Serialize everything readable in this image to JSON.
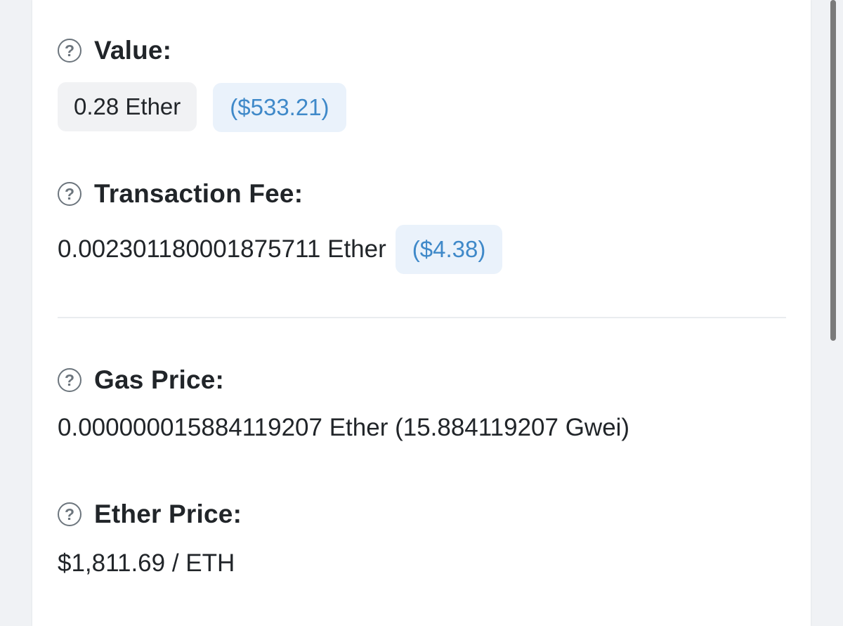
{
  "value": {
    "label": "Value:",
    "amount": "0.28 Ether",
    "usd": "($533.21)"
  },
  "transaction_fee": {
    "label": "Transaction Fee:",
    "amount": "0.002301180001875711 Ether",
    "usd": "($4.38)"
  },
  "gas_price": {
    "label": "Gas Price:",
    "amount": "0.000000015884119207 Ether (15.884119207 Gwei)"
  },
  "ether_price": {
    "label": "Ether Price:",
    "amount": "$1,811.69 / ETH"
  },
  "help_icon_glyph": "?",
  "colors": {
    "usd_pill_text": "#3f89c9",
    "usd_pill_bg": "#eaf2fb",
    "amount_pill_bg": "#f1f2f4"
  }
}
